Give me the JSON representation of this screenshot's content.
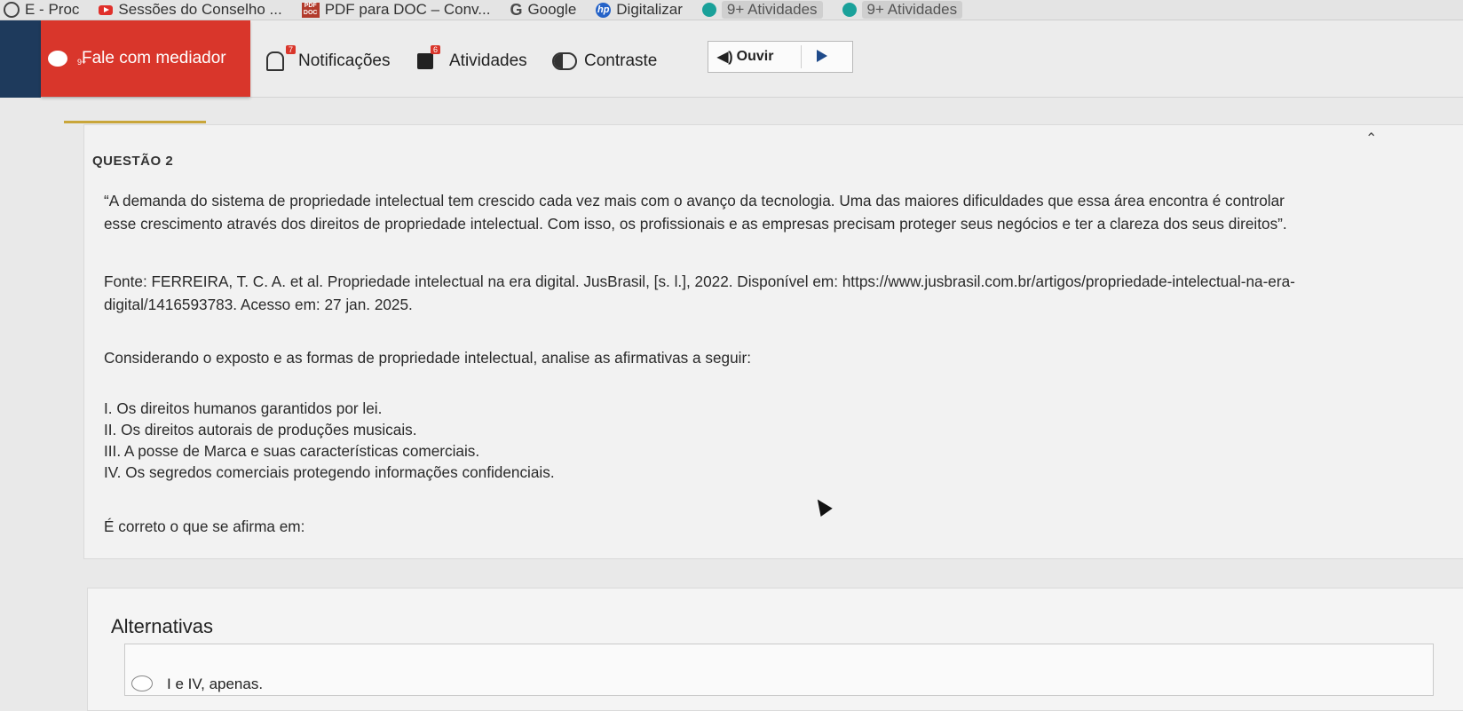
{
  "bookmarks": [
    {
      "label": "E - Proc",
      "icon": "globe-icon"
    },
    {
      "label": "Sessões do Conselho ...",
      "icon": "youtube-icon"
    },
    {
      "label": "PDF para DOC – Conv...",
      "icon": "pdf-icon"
    },
    {
      "label": "Google",
      "icon": "google-icon"
    },
    {
      "label": "Digitalizar",
      "icon": "hp-icon"
    },
    {
      "label": "9+ Atividades",
      "icon": "extension-icon"
    },
    {
      "label": "9+ Atividades",
      "icon": "extension-icon"
    }
  ],
  "toolbar": {
    "mediador_label": "Fale com mediador",
    "mediador_badge": "9+",
    "notificacoes_label": "Notificações",
    "notificacoes_badge": "7",
    "atividades_label": "Atividades",
    "atividades_badge": "6",
    "contraste_label": "Contraste",
    "ouvir_label": "Ouvir"
  },
  "question": {
    "title": "QUESTÃO 2",
    "quote_line1": "“A demanda do sistema de propriedade intelectual tem crescido cada vez mais com o avanço da tecnologia. Uma das maiores dificuldades que essa área encontra é controlar",
    "quote_line2": "esse crescimento através dos direitos de propriedade intelectual. Com isso, os profissionais e as empresas precisam proteger seus negócios e ter a clareza dos seus direitos”.",
    "source_line1": "Fonte: FERREIRA, T. C. A. et al. Propriedade intelectual na era digital. JusBrasil, [s. l.], 2022. Disponível em: https://www.jusbrasil.com.br/artigos/propriedade-intelectual-na-era-",
    "source_line2": "digital/1416593783. Acesso em: 27 jan. 2025.",
    "prompt": "Considerando o exposto e as formas de propriedade intelectual, analise as afirmativas a seguir:",
    "items": [
      "I. Os direitos humanos garantidos por lei.",
      "II. Os direitos autorais de produções musicais.",
      "III. A posse de Marca e suas características comerciais.",
      "IV. Os segredos comerciais protegendo informações confidenciais."
    ],
    "ask": "É correto o que se afirma em:"
  },
  "alternatives": {
    "title": "Alternativas",
    "options": [
      "I e IV, apenas."
    ]
  },
  "colors": {
    "mediador_red": "#d9362b",
    "navy": "#1e3a5c",
    "accent_gold": "#c9a63a"
  }
}
